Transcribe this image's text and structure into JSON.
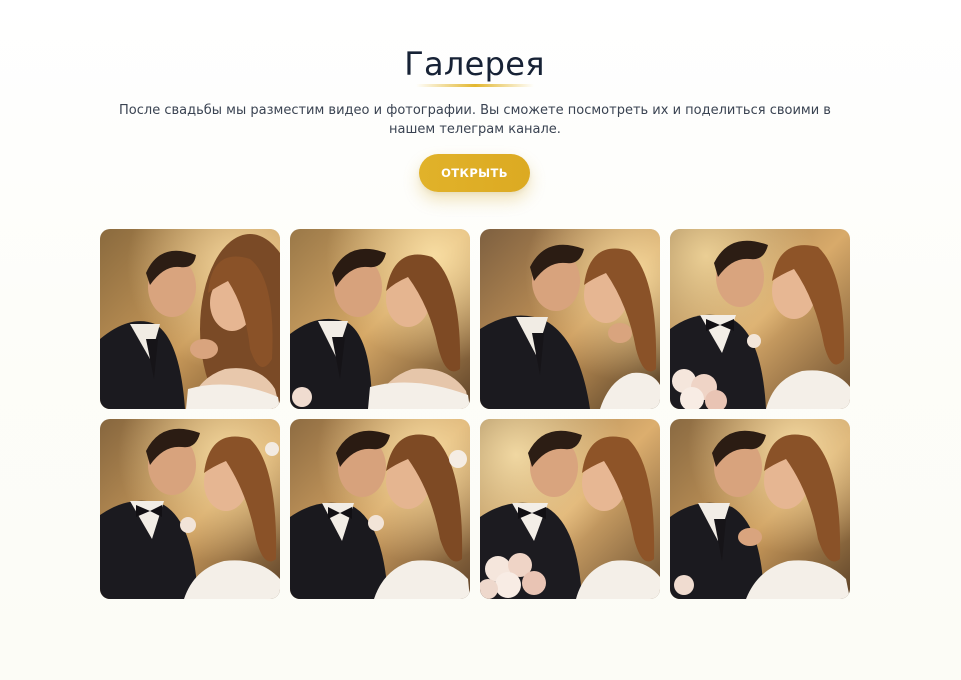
{
  "gallery_section": {
    "title": "Галерея",
    "description": "После свадьбы мы разместим видео и фотографии. Вы сможете посмотреть их и поделиться своими в нашем телеграм канале.",
    "button_label": "ОТКРЫТЬ"
  },
  "colors": {
    "accent": "#e0b02a",
    "title": "#172236",
    "text": "#3a4352"
  },
  "photos": [
    {
      "subject": "wedding-couple-photo"
    },
    {
      "subject": "wedding-couple-photo"
    },
    {
      "subject": "wedding-couple-photo"
    },
    {
      "subject": "wedding-couple-photo"
    },
    {
      "subject": "wedding-couple-photo"
    },
    {
      "subject": "wedding-couple-photo"
    },
    {
      "subject": "wedding-couple-photo"
    },
    {
      "subject": "wedding-couple-photo"
    }
  ]
}
